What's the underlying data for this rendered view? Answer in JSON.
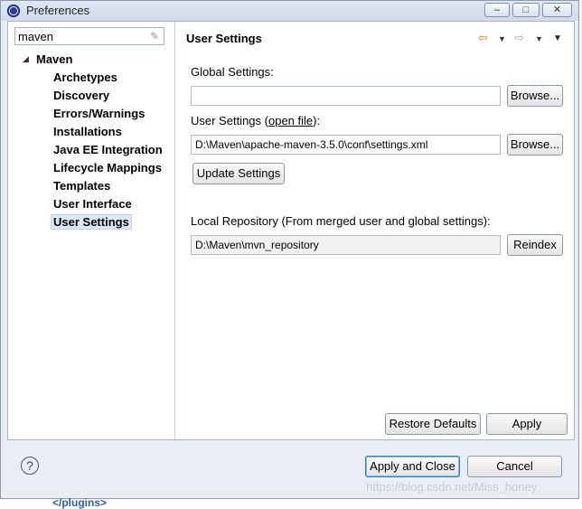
{
  "window": {
    "title": "Preferences",
    "min_symbol": "–",
    "max_symbol": "□",
    "close_symbol": "✕"
  },
  "filter": {
    "value": "maven"
  },
  "tree": {
    "root": "Maven",
    "items": [
      "Archetypes",
      "Discovery",
      "Errors/Warnings",
      "Installations",
      "Java EE Integration",
      "Lifecycle Mappings",
      "Templates",
      "User Interface",
      "User Settings"
    ],
    "selected": "User Settings"
  },
  "page": {
    "title": "User Settings",
    "global_label": "Global Settings:",
    "global_value": "",
    "user_label_prefix": "User Settings (",
    "user_label_link": "open file",
    "user_label_suffix": "):",
    "user_value": "D:\\Maven\\apache-maven-3.5.0\\conf\\settings.xml",
    "browse_label": "Browse...",
    "update_label": "Update Settings",
    "local_label": "Local Repository (From merged user and global settings):",
    "local_value": "D:\\Maven\\mvn_repository",
    "reindex_label": "Reindex",
    "restore_label": "Restore Defaults",
    "apply_label": "Apply"
  },
  "footer": {
    "help_symbol": "?",
    "apply_close_label": "Apply and Close",
    "cancel_label": "Cancel"
  },
  "background": {
    "watermark": "https://blog.csdn.net/Miss_honey",
    "partial_text": "</plugins>"
  },
  "colors": {
    "accent": "#3c7fb1",
    "selection": "#dbe8f7",
    "nav_arrow": "#b8860b"
  }
}
